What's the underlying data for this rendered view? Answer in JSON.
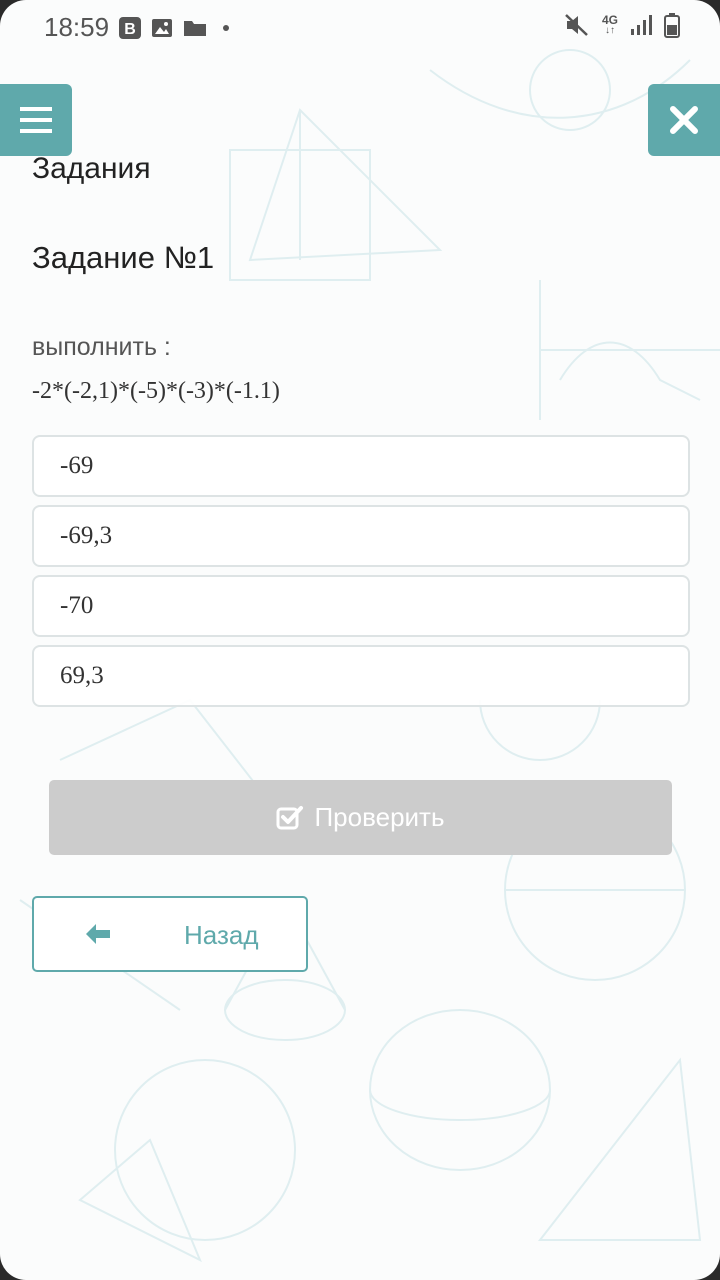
{
  "status_bar": {
    "time": "18:59",
    "network": "4G",
    "left_icons": [
      "vk-icon",
      "image-icon",
      "folder-icon",
      "dot-icon"
    ],
    "right_icons": [
      "mute-icon",
      "network-4g-icon",
      "signal-icon",
      "battery-icon"
    ]
  },
  "nav": {
    "menu_icon": "hamburger-menu-icon",
    "close_icon": "close-icon"
  },
  "page": {
    "section_title": "Задания",
    "task_title": "Задание №1",
    "prompt": "выполнить :",
    "expression": "-2*(-2,1)*(-5)*(-3)*(-1.1)"
  },
  "options": [
    {
      "label": "-69"
    },
    {
      "label": "-69,3"
    },
    {
      "label": "-70"
    },
    {
      "label": "69,3"
    }
  ],
  "actions": {
    "check_label": "Проверить",
    "check_icon": "check-square-icon",
    "back_label": "Назад",
    "back_icon": "arrow-left-icon"
  },
  "colors": {
    "accent": "#5fa9ab",
    "disabled_button": "#cccccc"
  }
}
